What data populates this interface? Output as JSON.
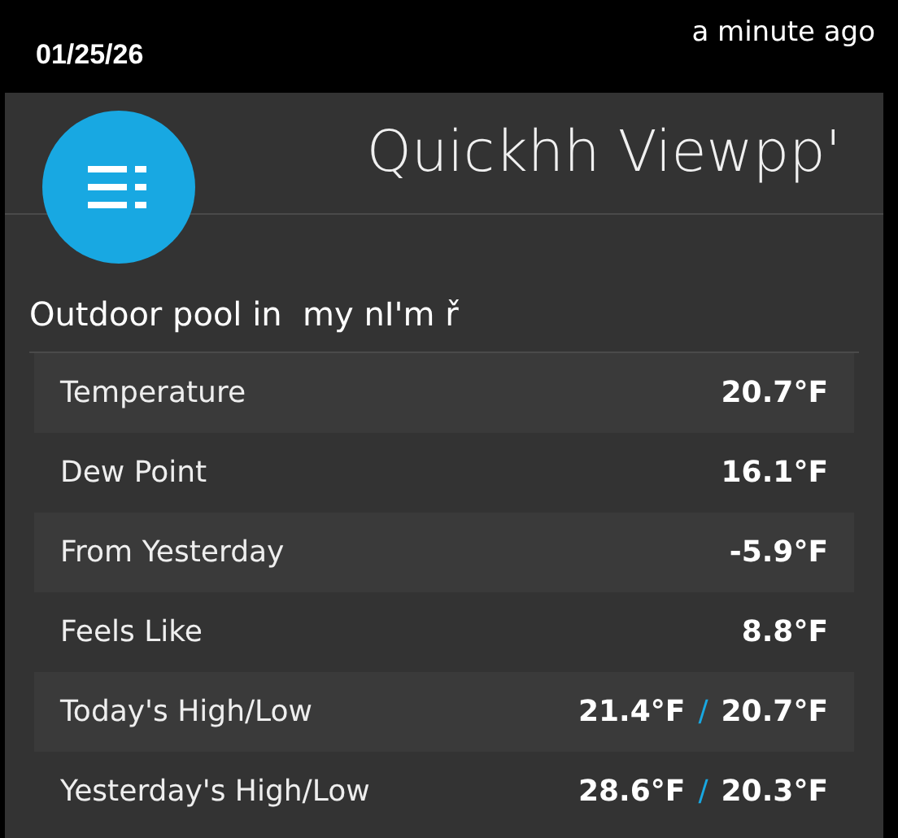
{
  "status_bar": {
    "date": "01/25/26",
    "updated": "a minute ago"
  },
  "header": {
    "title": "Quickhh Viewpp'"
  },
  "location": "Outdoor pool in  my nI'm ř",
  "rows": [
    {
      "kind": "single",
      "label": "Temperature",
      "value": "20.7°F"
    },
    {
      "kind": "single",
      "label": "Dew Point",
      "value": "16.1°F"
    },
    {
      "kind": "single",
      "label": "From Yesterday",
      "value": "-5.9°F"
    },
    {
      "kind": "single",
      "label": "Feels Like",
      "value": "8.8°F"
    },
    {
      "kind": "range",
      "label": "Today's High/Low",
      "high": "21.4°F",
      "separator": "/",
      "low": "20.7°F"
    },
    {
      "kind": "range",
      "label": "Yesterday's High/Low",
      "high": "28.6°F",
      "separator": "/",
      "low": "20.3°F"
    }
  ]
}
